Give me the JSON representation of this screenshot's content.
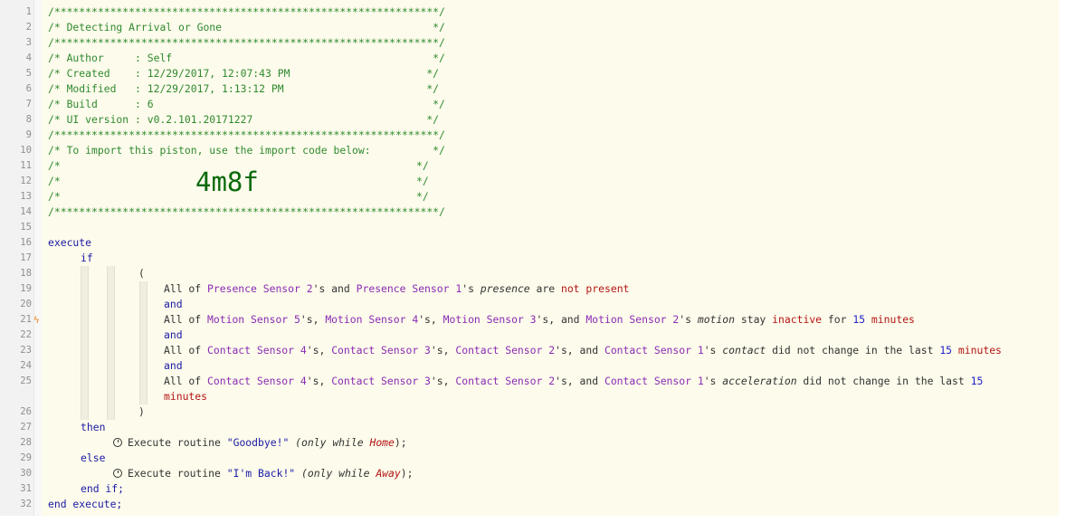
{
  "line_numbers": [
    "1",
    "2",
    "3",
    "4",
    "5",
    "6",
    "7",
    "8",
    "9",
    "10",
    "11",
    "12",
    "13",
    "14",
    "15",
    "16",
    "17",
    "18",
    "19",
    "20",
    "21",
    "22",
    "23",
    "24",
    "25",
    "26",
    "27",
    "28",
    "29",
    "30",
    "31",
    "32"
  ],
  "header": {
    "stars": "/**************************************************************/",
    "title": "/* Detecting Arrival or Gone                                  */",
    "author": "/* Author     : Self                                          */",
    "created": "/* Created    : 12/29/2017, 12:07:43 PM                      */",
    "modified": "/* Modified   : 12/29/2017, 1:13:12 PM                       */",
    "build": "/* Build      : 6                                             */",
    "ui_version": "/* UI version : v0.2.101.20171227                            */",
    "import_note": "/* To import this piston, use the import code below:          */",
    "blank_open": "/*",
    "blank_close": "*/",
    "import_code": "4m8f"
  },
  "code": {
    "execute": "execute",
    "if": "if",
    "open_paren": "(",
    "close_paren": ")",
    "and": "and",
    "then": "then",
    "else": "else",
    "end_if": "end if;",
    "end_execute": "end execute;",
    "all_of": "All of ",
    "possessive": "'s",
    "sep": "'s, ",
    "sep_and": "'s, and ",
    "and_word": " and ",
    "line19": {
      "dev1": "Presence Sensor 2",
      "dev2": "Presence Sensor 1",
      "attr": "presence",
      "are": " are ",
      "value": "not present"
    },
    "line21": {
      "dev1": "Motion Sensor 5",
      "dev2": "Motion Sensor 4",
      "dev3": "Motion Sensor 3",
      "dev4": "Motion Sensor 2",
      "attr": "motion",
      "stay": " stay ",
      "value": "inactive",
      "for": " for ",
      "num": "15",
      "unit": "minutes"
    },
    "line23": {
      "dev1": "Contact Sensor 4",
      "dev2": "Contact Sensor 3",
      "dev3": "Contact Sensor 2",
      "dev4": "Contact Sensor 1",
      "attr": "contact",
      "phrase": " did not change in the last ",
      "num": "15",
      "unit": "minutes"
    },
    "line25": {
      "dev1": "Contact Sensor 4",
      "dev2": "Contact Sensor 3",
      "dev3": "Contact Sensor 2",
      "dev4": "Contact Sensor 1",
      "attr": "acceleration",
      "phrase": " did not change in the last ",
      "num": "15",
      "unit": "minutes"
    },
    "line28": {
      "action": "Execute routine ",
      "routine": "\"Goodbye!\"",
      "only_open": " (only while ",
      "mode": "Home",
      "only_close": ");"
    },
    "line30": {
      "action": "Execute routine ",
      "routine": "\"I'm Back!\"",
      "only_open": " (only while ",
      "mode": "Away",
      "only_close": ");"
    }
  }
}
